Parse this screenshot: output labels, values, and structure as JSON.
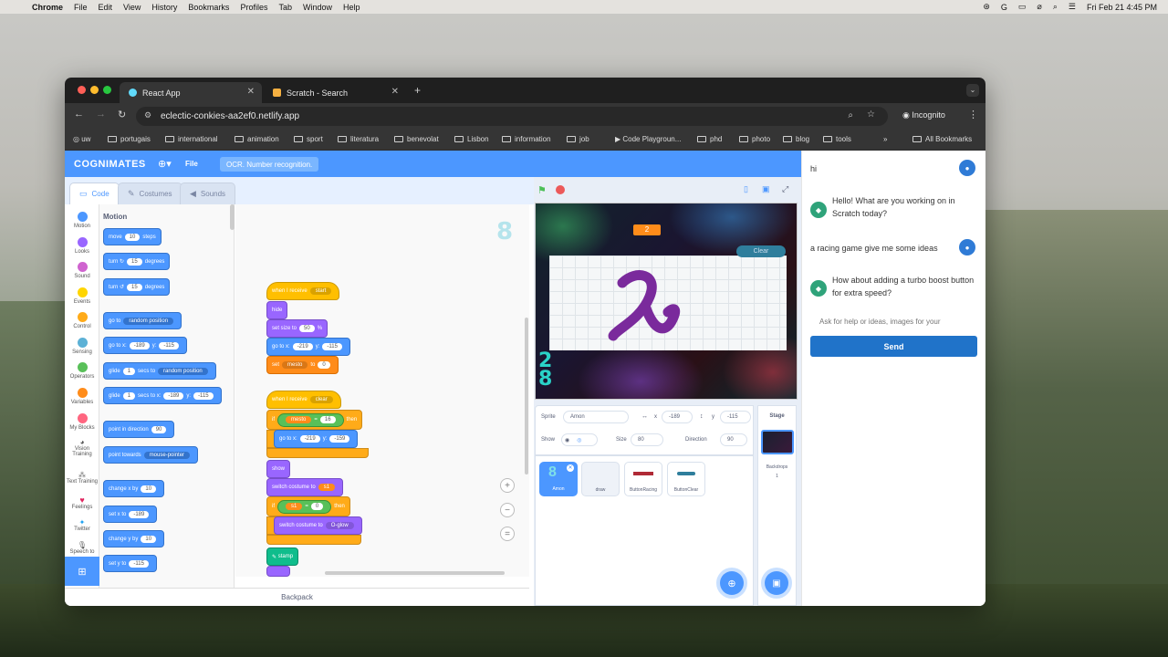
{
  "menubar": {
    "app": "Chrome",
    "items": [
      "File",
      "Edit",
      "View",
      "History",
      "Bookmarks",
      "Profiles",
      "Tab",
      "Window",
      "Help"
    ],
    "clock": "Fri Feb 21  4:45 PM"
  },
  "browser": {
    "tabs": [
      {
        "label": "React App",
        "active": true
      },
      {
        "label": "Scratch - Search",
        "active": false
      }
    ],
    "url": "eclectic-conkies-aa2ef0.netlify.app",
    "incognito": "Incognito",
    "bookmarks": [
      "uw",
      "portugais",
      "international",
      "animation",
      "sport",
      "literatura",
      "benevolat",
      "Lisbon",
      "information",
      "job",
      "Code Playgroun...",
      "phd",
      "photo",
      "blog",
      "tools"
    ],
    "all_bookmarks": "All Bookmarks"
  },
  "scratch": {
    "brand": "COGNIMATES",
    "file_menu": "File",
    "ocr_button": "OCR. Number recognition.",
    "tabs": {
      "code": "Code",
      "costumes": "Costumes",
      "sounds": "Sounds"
    },
    "categories": [
      {
        "label": "Motion",
        "color": "#4c97ff"
      },
      {
        "label": "Looks",
        "color": "#9966ff"
      },
      {
        "label": "Sound",
        "color": "#cf63cf"
      },
      {
        "label": "Events",
        "color": "#ffd500"
      },
      {
        "label": "Control",
        "color": "#ffab19"
      },
      {
        "label": "Sensing",
        "color": "#5cb1d6"
      },
      {
        "label": "Operators",
        "color": "#59c059"
      },
      {
        "label": "Variables",
        "color": "#ff8c1a"
      },
      {
        "label": "My Blocks",
        "color": "#ff6680"
      },
      {
        "label": "Vision Training",
        "color": "#222222"
      },
      {
        "label": "Text Training",
        "color": "#222222"
      },
      {
        "label": "Feelings",
        "color": "#e0245e"
      },
      {
        "label": "Twitter",
        "color": "#1da1f2"
      },
      {
        "label": "Speech to",
        "color": "#222222"
      }
    ],
    "palette": {
      "title": "Motion",
      "move": {
        "a": "move",
        "v": "10",
        "b": "steps"
      },
      "turn_right": {
        "a": "turn",
        "v": "15",
        "b": "degrees"
      },
      "turn_left": {
        "a": "turn",
        "v": "15",
        "b": "degrees"
      },
      "goto": {
        "a": "go to",
        "dd": "random position"
      },
      "goto_xy": {
        "a": "go to x:",
        "x": "-189",
        "b": "y:",
        "y": "-115"
      },
      "glide_random": {
        "a": "glide",
        "v": "1",
        "b": "secs to",
        "dd": "random position"
      },
      "glide_xy": {
        "a": "glide",
        "v": "1",
        "b": "secs to x:",
        "x": "-189",
        "c": "y:",
        "y": "-115"
      },
      "point_dir": {
        "a": "point in direction",
        "v": "90"
      },
      "point_towards": {
        "a": "point towards",
        "dd": "mouse-pointer"
      },
      "change_x": {
        "a": "change x by",
        "v": "10"
      },
      "set_x": {
        "a": "set x to",
        "v": "-189"
      },
      "change_y": {
        "a": "change y by",
        "v": "10"
      },
      "set_y": {
        "a": "set y to",
        "v": "-115"
      }
    },
    "script1": {
      "hat": {
        "a": "when I receive",
        "dd": "start"
      },
      "hide": "hide",
      "size": {
        "a": "set size to",
        "v": "50",
        "b": "%"
      },
      "goto": {
        "a": "go to x:",
        "x": "-219",
        "b": "y:",
        "y": "-115"
      },
      "setvar": {
        "a": "set",
        "dd": "mesto",
        "b": "to",
        "v": "0"
      }
    },
    "script2": {
      "hat": {
        "a": "when I receive",
        "dd": "clear"
      },
      "if": {
        "a": "if",
        "var": "mesto",
        "op": "=",
        "v": "16",
        "b": "then"
      },
      "goto": {
        "a": "go to x:",
        "x": "-219",
        "b": "y:",
        "y": "-159"
      },
      "show": "show",
      "costume": {
        "a": "switch costume to",
        "v": "s1"
      },
      "if2": {
        "a": "if",
        "var": "s1",
        "op": "=",
        "v": "0",
        "b": "then"
      },
      "costume2": {
        "a": "switch costume to",
        "dd": "O-glow"
      },
      "stamp": "stamp"
    },
    "ghost_digit": "8",
    "backpack": "Backpack",
    "stage": {
      "score": "2",
      "clear_tag": "Clear",
      "digits": "2\n8"
    },
    "sprite_info": {
      "sprite_label": "Sprite",
      "sprite_name": "Amon",
      "x_label": "x",
      "x": "-189",
      "y_label": "y",
      "y": "-115",
      "show_label": "Show",
      "size_label": "Size",
      "size": "80",
      "direction_label": "Direction",
      "direction": "90"
    },
    "sprites": [
      "Amon",
      "draw",
      "ButtonRacing",
      "ButtonClear"
    ],
    "stage_col": {
      "title": "Stage",
      "backdrops_label": "Backdrops",
      "backdrops_count": "1"
    }
  },
  "chat": {
    "messages": [
      {
        "role": "user",
        "text": "hi"
      },
      {
        "role": "bot",
        "text": "Hello! What are you working on in Scratch today?"
      },
      {
        "role": "user",
        "text": "a racing game give me some ideas"
      },
      {
        "role": "bot",
        "text": "How about adding a turbo boost button for extra speed?"
      }
    ],
    "placeholder": "Ask for help or ideas, images for your",
    "send_label": "Send"
  }
}
